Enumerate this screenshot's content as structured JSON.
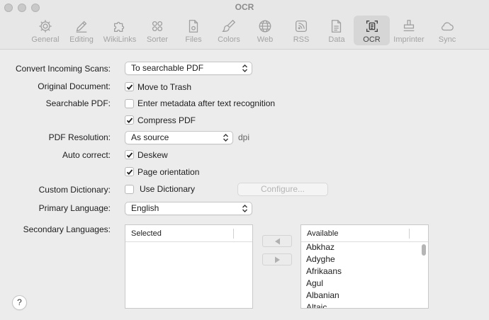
{
  "window": {
    "title": "OCR"
  },
  "toolbar": [
    {
      "label": "General",
      "icon": "gear-icon"
    },
    {
      "label": "Editing",
      "icon": "pencil-icon"
    },
    {
      "label": "WikiLinks",
      "icon": "puzzle-icon"
    },
    {
      "label": "Sorter",
      "icon": "circles-icon"
    },
    {
      "label": "Files",
      "icon": "document-gear-icon"
    },
    {
      "label": "Colors",
      "icon": "paintbrush-icon"
    },
    {
      "label": "Web",
      "icon": "globe-icon"
    },
    {
      "label": "RSS",
      "icon": "rss-icon"
    },
    {
      "label": "Data",
      "icon": "database-document-icon"
    },
    {
      "label": "OCR",
      "icon": "scan-text-icon"
    },
    {
      "label": "Imprinter",
      "icon": "stamp-icon"
    },
    {
      "label": "Sync",
      "icon": "cloud-icon"
    }
  ],
  "active_tab": "OCR",
  "form": {
    "convert_label": "Convert Incoming Scans:",
    "convert_value": "To searchable PDF",
    "original_label": "Original Document:",
    "move_to_trash": {
      "label": "Move to Trash",
      "checked": true
    },
    "searchable_label": "Searchable PDF:",
    "enter_metadata": {
      "label": "Enter metadata after text recognition",
      "checked": false
    },
    "compress_pdf": {
      "label": "Compress PDF",
      "checked": true
    },
    "resolution_label": "PDF Resolution:",
    "resolution_value": "As source",
    "resolution_unit": "dpi",
    "autocorrect_label": "Auto correct:",
    "deskew": {
      "label": "Deskew",
      "checked": true
    },
    "page_orientation": {
      "label": "Page orientation",
      "checked": true
    },
    "dictionary_label": "Custom Dictionary:",
    "use_dictionary": {
      "label": "Use Dictionary",
      "checked": false
    },
    "configure_label": "Configure...",
    "primary_label": "Primary Language:",
    "primary_value": "English",
    "secondary_label": "Secondary Languages:"
  },
  "selected_list": {
    "header": "Selected",
    "items": []
  },
  "available_list": {
    "header": "Available",
    "items": [
      "Abkhaz",
      "Adyghe",
      "Afrikaans",
      "Agul",
      "Albanian",
      "Altaic"
    ]
  },
  "help_label": "?",
  "colors": {
    "checkmark": "#1d1d1f",
    "active_tab_bg": "#d6d6d6",
    "window_bg": "#ececec"
  }
}
